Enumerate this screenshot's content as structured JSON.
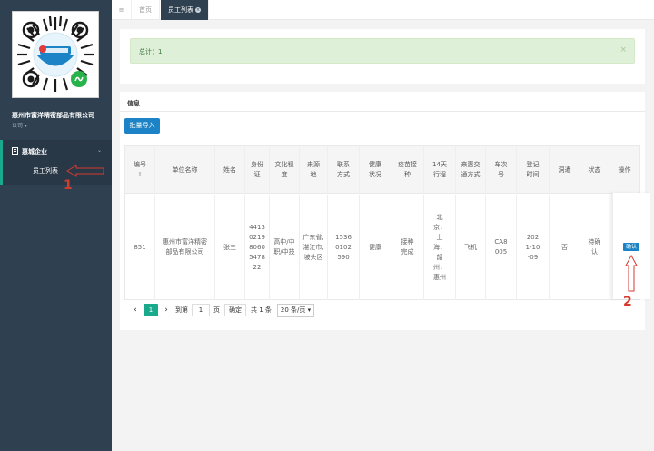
{
  "sidebar": {
    "company": "惠州市富洋精密部品有限公司",
    "role": "公司",
    "nav_group": "惠城企业",
    "nav_sub": "员工列表"
  },
  "annotations": {
    "one": "1",
    "two": "2"
  },
  "tabs": [
    {
      "label": "≡"
    },
    {
      "label": "首页"
    },
    {
      "label": "员工列表"
    }
  ],
  "alert": {
    "text": "总计：1",
    "close": "×"
  },
  "panel": {
    "title": "信息",
    "import_label": "批量导入"
  },
  "table": {
    "headers": [
      "编号",
      "单位名称",
      "姓名",
      "身份证",
      "文化程度",
      "来源地",
      "联系方式",
      "健康状况",
      "疫苗接种",
      "14天行程",
      "来惠交通方式",
      "车次号",
      "登记时间",
      "洞遣",
      "状态",
      "操作"
    ],
    "row": {
      "id": "851",
      "company": "惠州市富洋精密部品有限公司",
      "name": "张三",
      "id_card": "441302198060547822",
      "education": "高中/中职/中技",
      "origin": "广东省,湛江市,坡头区",
      "phone": "15360102590",
      "health": "健康",
      "vaccine": "接种完成",
      "itinerary": "北京，上海，韶州，惠州",
      "transport": "飞机",
      "train_no": "CA8005",
      "reg_time": "2021-10-09",
      "isolation": "否",
      "status": "待确认",
      "action": "确认"
    }
  },
  "pagination": {
    "prev": "‹",
    "current": "1",
    "next": "›",
    "goto_label": "到第",
    "goto_value": "1",
    "page_label": "页",
    "confirm": "确定",
    "total": "共 1 条",
    "page_size": "20 条/页"
  }
}
